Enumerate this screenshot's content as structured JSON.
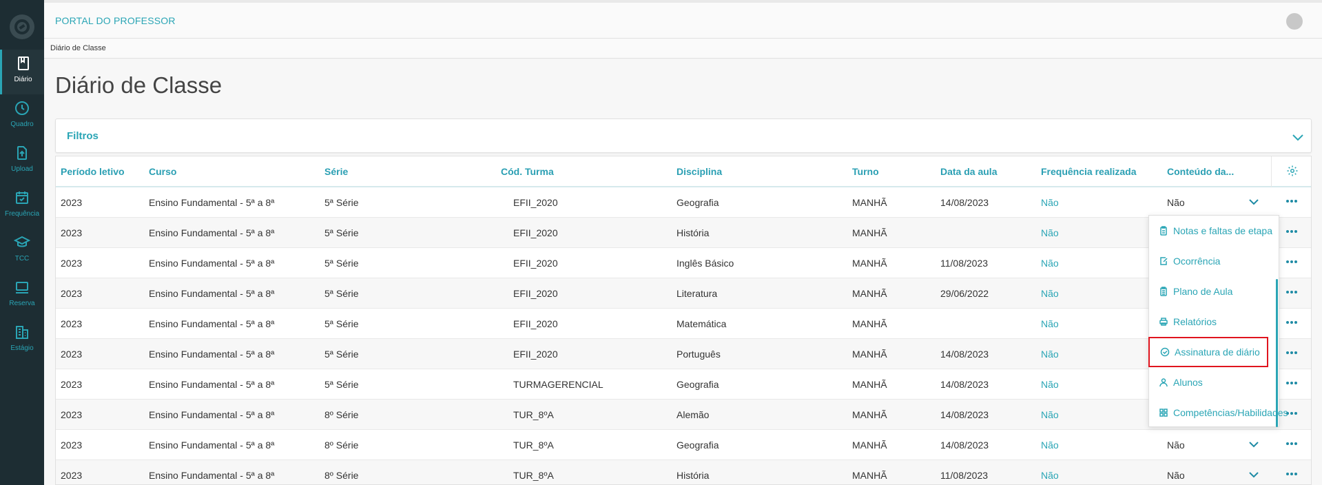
{
  "sidebar": {
    "items": [
      {
        "label": "Diário",
        "icon": "book-icon",
        "active": true
      },
      {
        "label": "Quadro",
        "icon": "clock-icon"
      },
      {
        "label": "Upload",
        "icon": "upload-icon"
      },
      {
        "label": "Frequência",
        "icon": "calendar-check-icon"
      },
      {
        "label": "TCC",
        "icon": "graduation-cap-icon"
      },
      {
        "label": "Reserva",
        "icon": "monitor-icon"
      },
      {
        "label": "Estágio",
        "icon": "building-icon"
      }
    ]
  },
  "header": {
    "title": "PORTAL DO PROFESSOR"
  },
  "breadcrumb": "Diário de Classe",
  "page": {
    "title": "Diário de Classe"
  },
  "filters": {
    "title": "Filtros"
  },
  "table": {
    "columns": [
      "Período letivo",
      "Curso",
      "Série",
      "Cód. Turma",
      "Disciplina",
      "Turno",
      "Data da aula",
      "Frequência realizada",
      "Conteúdo da..."
    ],
    "rows": [
      {
        "periodo": "2023",
        "curso": "Ensino Fundamental - 5ª a 8ª",
        "serie": "5ª Série",
        "turma": "EFII_2020",
        "disciplina": "Geografia",
        "turno": "MANHÃ",
        "data": "14/08/2023",
        "frequencia": "Não",
        "conteudo": "Não"
      },
      {
        "periodo": "2023",
        "curso": "Ensino Fundamental - 5ª a 8ª",
        "serie": "5ª Série",
        "turma": "EFII_2020",
        "disciplina": "História",
        "turno": "MANHÃ",
        "data": "",
        "frequencia": "Não",
        "conteudo": ""
      },
      {
        "periodo": "2023",
        "curso": "Ensino Fundamental - 5ª a 8ª",
        "serie": "5ª Série",
        "turma": "EFII_2020",
        "disciplina": "Inglês Básico",
        "turno": "MANHÃ",
        "data": "11/08/2023",
        "frequencia": "Não",
        "conteudo": ""
      },
      {
        "periodo": "2023",
        "curso": "Ensino Fundamental - 5ª a 8ª",
        "serie": "5ª Série",
        "turma": "EFII_2020",
        "disciplina": "Literatura",
        "turno": "MANHÃ",
        "data": "29/06/2022",
        "frequencia": "Não",
        "conteudo": ""
      },
      {
        "periodo": "2023",
        "curso": "Ensino Fundamental - 5ª a 8ª",
        "serie": "5ª Série",
        "turma": "EFII_2020",
        "disciplina": "Matemática",
        "turno": "MANHÃ",
        "data": "",
        "frequencia": "Não",
        "conteudo": ""
      },
      {
        "periodo": "2023",
        "curso": "Ensino Fundamental - 5ª a 8ª",
        "serie": "5ª Série",
        "turma": "EFII_2020",
        "disciplina": "Português",
        "turno": "MANHÃ",
        "data": "14/08/2023",
        "frequencia": "Não",
        "conteudo": ""
      },
      {
        "periodo": "2023",
        "curso": "Ensino Fundamental - 5ª a 8ª",
        "serie": "5ª Série",
        "turma": "TURMAGERENCIAL",
        "disciplina": "Geografia",
        "turno": "MANHÃ",
        "data": "14/08/2023",
        "frequencia": "Não",
        "conteudo": ""
      },
      {
        "periodo": "2023",
        "curso": "Ensino Fundamental - 5ª a 8ª",
        "serie": "8º Série",
        "turma": "TUR_8ºA",
        "disciplina": "Alemão",
        "turno": "MANHÃ",
        "data": "14/08/2023",
        "frequencia": "Não",
        "conteudo": ""
      },
      {
        "periodo": "2023",
        "curso": "Ensino Fundamental - 5ª a 8ª",
        "serie": "8º Série",
        "turma": "TUR_8ºA",
        "disciplina": "Geografia",
        "turno": "MANHÃ",
        "data": "14/08/2023",
        "frequencia": "Não",
        "conteudo": "Não"
      },
      {
        "periodo": "2023",
        "curso": "Ensino Fundamental - 5ª a 8ª",
        "serie": "8º Série",
        "turma": "TUR_8ºA",
        "disciplina": "História",
        "turno": "MANHÃ",
        "data": "11/08/2023",
        "frequencia": "Não",
        "conteudo": "Não"
      }
    ]
  },
  "menu": {
    "items": [
      {
        "label": "Notas e faltas de etapa",
        "icon": "clipboard-icon"
      },
      {
        "label": "Ocorrência",
        "icon": "edit-note-icon"
      },
      {
        "label": "Plano de Aula",
        "icon": "clipboard-list-icon"
      },
      {
        "label": "Relatórios",
        "icon": "printer-icon"
      },
      {
        "label": "Assinatura de diário",
        "icon": "check-circle-icon",
        "highlighted": true
      },
      {
        "label": "Alunos",
        "icon": "user-icon"
      },
      {
        "label": "Competências/Habilidades",
        "icon": "grid-icon"
      }
    ]
  },
  "colors": {
    "accent": "#2aa5b5",
    "sidebar_bg": "#1d2d33",
    "highlight_border": "#e0141e"
  }
}
